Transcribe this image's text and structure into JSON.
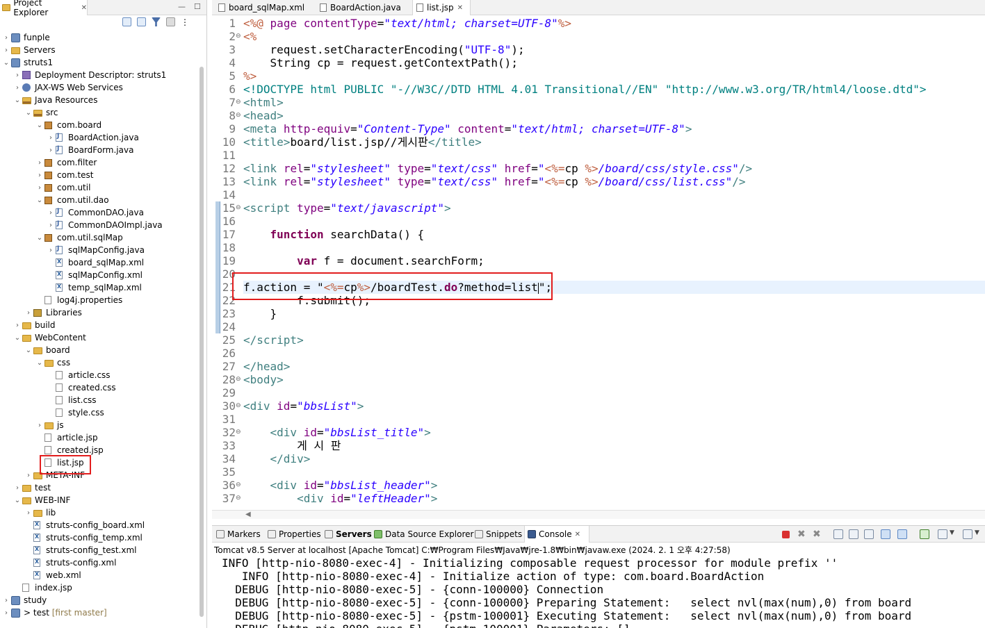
{
  "explorer": {
    "tab_title": "Project Explorer",
    "close_glyph": "✕",
    "minimize_glyph": "—",
    "maximize_glyph": "☐",
    "tree": [
      {
        "label": "funple",
        "icon": "project-icon",
        "twisty": ">"
      },
      {
        "label": "Servers",
        "icon": "folder-icon",
        "twisty": ">"
      },
      {
        "label": "struts1",
        "icon": "project-icon",
        "twisty": "v"
      },
      {
        "label": "Deployment Descriptor: struts1",
        "icon": "deployment-descriptor-icon",
        "twisty": ">"
      },
      {
        "label": "JAX-WS Web Services",
        "icon": "web-services-icon",
        "twisty": ">"
      },
      {
        "label": "Java Resources",
        "icon": "java-resources-icon",
        "twisty": "v"
      },
      {
        "label": "src",
        "icon": "source-folder-icon",
        "twisty": "v"
      },
      {
        "label": "com.board",
        "icon": "package-icon",
        "twisty": "v"
      },
      {
        "label": "BoardAction.java",
        "icon": "java-file-icon",
        "twisty": ">"
      },
      {
        "label": "BoardForm.java",
        "icon": "java-file-icon",
        "twisty": ">"
      },
      {
        "label": "com.filter",
        "icon": "package-icon",
        "twisty": ">"
      },
      {
        "label": "com.test",
        "icon": "package-icon",
        "twisty": ">"
      },
      {
        "label": "com.util",
        "icon": "package-icon",
        "twisty": ">"
      },
      {
        "label": "com.util.dao",
        "icon": "package-icon",
        "twisty": "v"
      },
      {
        "label": "CommonDAO.java",
        "icon": "java-file-icon",
        "twisty": ">"
      },
      {
        "label": "CommonDAOImpl.java",
        "icon": "java-file-icon",
        "twisty": ">"
      },
      {
        "label": "com.util.sqlMap",
        "icon": "package-icon",
        "twisty": "v"
      },
      {
        "label": "sqlMapConfig.java",
        "icon": "java-file-icon",
        "twisty": ">"
      },
      {
        "label": "board_sqlMap.xml",
        "icon": "xml-file-icon",
        "twisty": ""
      },
      {
        "label": "sqlMapConfig.xml",
        "icon": "xml-file-icon",
        "twisty": ""
      },
      {
        "label": "temp_sqlMap.xml",
        "icon": "xml-file-icon",
        "twisty": ""
      },
      {
        "label": "log4j.properties",
        "icon": "file-icon",
        "twisty": ""
      },
      {
        "label": "Libraries",
        "icon": "library-icon",
        "twisty": ">"
      },
      {
        "label": "build",
        "icon": "folder-icon",
        "twisty": ">"
      },
      {
        "label": "WebContent",
        "icon": "folder-icon",
        "twisty": "v"
      },
      {
        "label": "board",
        "icon": "folder-icon",
        "twisty": "v"
      },
      {
        "label": "css",
        "icon": "folder-icon",
        "twisty": "v"
      },
      {
        "label": "article.css",
        "icon": "file-icon",
        "twisty": ""
      },
      {
        "label": "created.css",
        "icon": "file-icon",
        "twisty": ""
      },
      {
        "label": "list.css",
        "icon": "file-icon",
        "twisty": ""
      },
      {
        "label": "style.css",
        "icon": "file-icon",
        "twisty": ""
      },
      {
        "label": "js",
        "icon": "folder-icon",
        "twisty": ">"
      },
      {
        "label": "article.jsp",
        "icon": "file-icon",
        "twisty": ""
      },
      {
        "label": "created.jsp",
        "icon": "file-icon",
        "twisty": ""
      },
      {
        "label": "list.jsp",
        "icon": "file-icon",
        "twisty": ""
      },
      {
        "label": "META-INF",
        "icon": "folder-icon",
        "twisty": ">"
      },
      {
        "label": "test",
        "icon": "folder-icon",
        "twisty": ">"
      },
      {
        "label": "WEB-INF",
        "icon": "folder-icon",
        "twisty": "v"
      },
      {
        "label": "lib",
        "icon": "folder-icon",
        "twisty": ">"
      },
      {
        "label": "struts-config_board.xml",
        "icon": "xml-file-icon",
        "twisty": ""
      },
      {
        "label": "struts-config_temp.xml",
        "icon": "xml-file-icon",
        "twisty": ""
      },
      {
        "label": "struts-config_test.xml",
        "icon": "xml-file-icon",
        "twisty": ""
      },
      {
        "label": "struts-config.xml",
        "icon": "xml-file-icon",
        "twisty": ""
      },
      {
        "label": "web.xml",
        "icon": "xml-file-icon",
        "twisty": ""
      },
      {
        "label": "index.jsp",
        "icon": "file-icon",
        "twisty": ""
      },
      {
        "label": "study",
        "icon": "project-icon",
        "twisty": ">"
      },
      {
        "label": "> test",
        "icon": "project-icon",
        "twisty": ">",
        "suffix": "[first master]"
      }
    ]
  },
  "editor": {
    "tabs": [
      {
        "label": "board_sqlMap.xml",
        "active": false
      },
      {
        "label": "BoardAction.java",
        "active": false
      },
      {
        "label": "list.jsp",
        "active": true
      }
    ],
    "lines": [
      {
        "n": "1",
        "fold": false,
        "html": "<span class=\"jd\">&lt;%@</span> <span class=\"an\">page</span> <span class=\"an\">contentType</span>=<span class=\"av\">\"text/html; charset=UTF-8\"</span><span class=\"jd\">%&gt;</span>"
      },
      {
        "n": "2",
        "fold": true,
        "html": "<span class=\"jd\">&lt;%</span>"
      },
      {
        "n": "3",
        "fold": false,
        "html": "    request.setCharacterEncoding(<span class=\"st\">\"UTF-8\"</span>);"
      },
      {
        "n": "4",
        "fold": false,
        "html": "    String cp = request.getContextPath();"
      },
      {
        "n": "5",
        "fold": false,
        "html": "<span class=\"jd\">%&gt;</span>"
      },
      {
        "n": "6",
        "fold": false,
        "html": "<span class=\"dt\">&lt;!DOCTYPE html PUBLIC \"-//W3C//DTD HTML 4.01 Transitional//EN\" \"http://www.w3.org/TR/html4/loose.dtd\"&gt;</span>"
      },
      {
        "n": "7",
        "fold": true,
        "html": "<span class=\"tg\">&lt;html&gt;</span>"
      },
      {
        "n": "8",
        "fold": true,
        "html": "<span class=\"tg\">&lt;head&gt;</span>"
      },
      {
        "n": "9",
        "fold": false,
        "html": "<span class=\"tg\">&lt;meta</span> <span class=\"an\">http-equiv</span>=<span class=\"av\">\"Content-Type\"</span> <span class=\"an\">content</span>=<span class=\"av\">\"text/html; charset=UTF-8\"</span><span class=\"tg\">&gt;</span>"
      },
      {
        "n": "10",
        "fold": false,
        "html": "<span class=\"tg\">&lt;title&gt;</span>board/list.jsp//게시판<span class=\"tg\">&lt;/title&gt;</span>"
      },
      {
        "n": "11",
        "fold": false,
        "html": ""
      },
      {
        "n": "12",
        "fold": false,
        "html": "<span class=\"tg\">&lt;link</span> <span class=\"an\">rel</span>=<span class=\"av\">\"stylesheet\"</span> <span class=\"an\">type</span>=<span class=\"av\">\"text/css\"</span> <span class=\"an\">href</span>=<span class=\"av\">\"</span><span class=\"jd\">&lt;%=</span>cp <span class=\"jd\">%&gt;</span><span class=\"av\">/board/css/style.css\"</span><span class=\"tg\">/&gt;</span>"
      },
      {
        "n": "13",
        "fold": false,
        "html": "<span class=\"tg\">&lt;link</span> <span class=\"an\">rel</span>=<span class=\"av\">\"stylesheet\"</span> <span class=\"an\">type</span>=<span class=\"av\">\"text/css\"</span> <span class=\"an\">href</span>=<span class=\"av\">\"</span><span class=\"jd\">&lt;%=</span>cp <span class=\"jd\">%&gt;</span><span class=\"av\">/board/css/list.css\"</span><span class=\"tg\">/&gt;</span>"
      },
      {
        "n": "14",
        "fold": false,
        "html": ""
      },
      {
        "n": "15",
        "fold": true,
        "html": "<span class=\"tg\">&lt;script</span> <span class=\"an\">type</span>=<span class=\"av\">\"text/javascript\"</span><span class=\"tg\">&gt;</span>"
      },
      {
        "n": "16",
        "fold": false,
        "html": ""
      },
      {
        "n": "17",
        "fold": false,
        "html": "    <span class=\"kw\">function</span> searchData() {"
      },
      {
        "n": "18",
        "fold": false,
        "html": ""
      },
      {
        "n": "19",
        "fold": false,
        "html": "        <span class=\"kw\">var</span> f = document.searchForm;"
      },
      {
        "n": "20",
        "fold": false,
        "html": ""
      },
      {
        "n": "21",
        "fold": false,
        "html": "f.action = \"<span class=\"jd\">&lt;%=</span>cp<span class=\"jd\">%&gt;</span>/boardTest.<span class=\"kw\">do</span>?method=list<span class=\"caret\"></span>\";"
      },
      {
        "n": "22",
        "fold": false,
        "html": "        f.submit();"
      },
      {
        "n": "23",
        "fold": false,
        "html": "    }"
      },
      {
        "n": "24",
        "fold": false,
        "html": ""
      },
      {
        "n": "25",
        "fold": false,
        "html": "<span class=\"tg\">&lt;/script&gt;</span>"
      },
      {
        "n": "26",
        "fold": false,
        "html": ""
      },
      {
        "n": "27",
        "fold": false,
        "html": "<span class=\"tg\">&lt;/head&gt;</span>"
      },
      {
        "n": "28",
        "fold": true,
        "html": "<span class=\"tg\">&lt;body&gt;</span>"
      },
      {
        "n": "29",
        "fold": false,
        "html": ""
      },
      {
        "n": "30",
        "fold": true,
        "html": "<span class=\"tg\">&lt;div</span> <span class=\"an\">id</span>=<span class=\"av\">\"bbsList\"</span><span class=\"tg\">&gt;</span>"
      },
      {
        "n": "31",
        "fold": false,
        "html": ""
      },
      {
        "n": "32",
        "fold": true,
        "html": "    <span class=\"tg\">&lt;div</span> <span class=\"an\">id</span>=<span class=\"av\">\"bbsList_title\"</span><span class=\"tg\">&gt;</span>"
      },
      {
        "n": "33",
        "fold": false,
        "html": "        게 시 판"
      },
      {
        "n": "34",
        "fold": false,
        "html": "    <span class=\"tg\">&lt;/div&gt;</span>"
      },
      {
        "n": "35",
        "fold": false,
        "html": ""
      },
      {
        "n": "36",
        "fold": true,
        "html": "    <span class=\"tg\">&lt;div</span> <span class=\"an\">id</span>=<span class=\"av\">\"bbsList_header\"</span><span class=\"tg\">&gt;</span>"
      },
      {
        "n": "37",
        "fold": true,
        "html": "        <span class=\"tg\">&lt;div</span> <span class=\"an\">id</span>=<span class=\"av\">\"leftHeader\"</span><span class=\"tg\">&gt;</span>"
      }
    ]
  },
  "console": {
    "tabs": [
      {
        "label": "Markers",
        "icon": "markers-icon"
      },
      {
        "label": "Properties",
        "icon": "properties-icon"
      },
      {
        "label": "Servers",
        "icon": "servers-icon"
      },
      {
        "label": "Data Source Explorer",
        "icon": "data-source-icon"
      },
      {
        "label": "Snippets",
        "icon": "snippets-icon"
      },
      {
        "label": "Console",
        "icon": "console-icon"
      }
    ],
    "close_glyph": "✕",
    "process": "Tomcat v8.5 Server at localhost [Apache Tomcat] C:₩Program Files₩Java₩jre-1.8₩bin₩javaw.exe  (2024. 2. 1 오후 4:27:58)",
    "output": [
      "INFO [http-nio-8080-exec-4] - Initializing composable request processor for module prefix ''",
      "   INFO [http-nio-8080-exec-4] - Initialize action of type: com.board.BoardAction",
      "  DEBUG [http-nio-8080-exec-5] - {conn-100000} Connection",
      "  DEBUG [http-nio-8080-exec-5] - {conn-100000} Preparing Statement:   select nvl(max(num),0) from board",
      "  DEBUG [http-nio-8080-exec-5] - {pstm-100001} Executing Statement:   select nvl(max(num),0) from board",
      "  DEBUG [http-nio-8080-exec-5] - {pstm-100001} Parameters: []"
    ]
  },
  "colors": {
    "highlight_box": "#e21d1d",
    "current_line": "#e8f2fe"
  }
}
